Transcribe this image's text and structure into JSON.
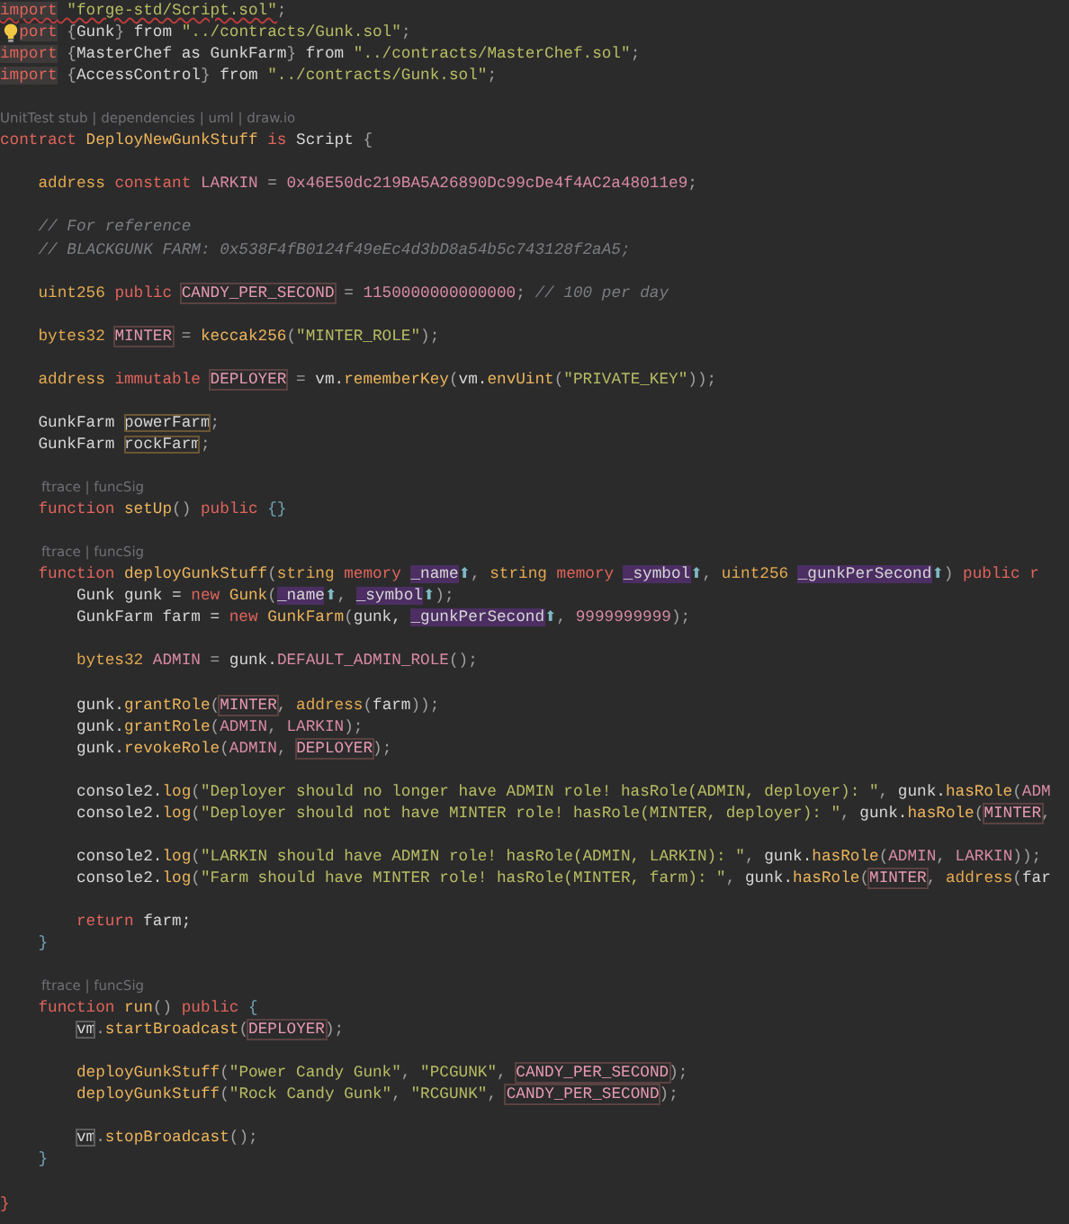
{
  "editor": {
    "lines": [
      {
        "kind": "code",
        "tokens": [
          {
            "kind": "err",
            "text": "import"
          },
          {
            "kind": "errs",
            "text": " \"forge-std/Script.sol\""
          },
          {
            "kind": "pun",
            "text": ";"
          }
        ]
      },
      {
        "kind": "code",
        "hint": true,
        "tokens": [
          {
            "kind": "imp",
            "text": "port"
          },
          {
            "kind": "pun",
            "text": " {"
          },
          {
            "kind": "id",
            "text": "Gunk"
          },
          {
            "kind": "pun",
            "text": "}"
          },
          {
            "kind": "id",
            "text": " from "
          },
          {
            "kind": "str",
            "text": "\"../contracts/Gunk.sol\""
          },
          {
            "kind": "pun",
            "text": ";"
          }
        ]
      },
      {
        "kind": "code",
        "tokens": [
          {
            "kind": "imp",
            "text": "import"
          },
          {
            "kind": "pun",
            "text": " {"
          },
          {
            "kind": "id",
            "text": "MasterChef as GunkFarm"
          },
          {
            "kind": "pun",
            "text": "}"
          },
          {
            "kind": "id",
            "text": " from "
          },
          {
            "kind": "str",
            "text": "\"../contracts/MasterChef.sol\""
          },
          {
            "kind": "pun",
            "text": ";"
          }
        ]
      },
      {
        "kind": "code",
        "tokens": [
          {
            "kind": "imp",
            "text": "import"
          },
          {
            "kind": "pun",
            "text": " {"
          },
          {
            "kind": "id",
            "text": "AccessControl"
          },
          {
            "kind": "pun",
            "text": "}"
          },
          {
            "kind": "id",
            "text": " from "
          },
          {
            "kind": "str",
            "text": "\"../contracts/Gunk.sol\""
          },
          {
            "kind": "pun",
            "text": ";"
          }
        ]
      },
      {
        "kind": "blank"
      },
      {
        "kind": "lens",
        "text": "UnitTest stub | dependencies | uml | draw.io"
      },
      {
        "kind": "code",
        "tokens": [
          {
            "kind": "kw",
            "text": "contract "
          },
          {
            "kind": "fn",
            "text": "DeployNewGunkStuff "
          },
          {
            "kind": "kw",
            "text": "is"
          },
          {
            "kind": "id",
            "text": " Script"
          },
          {
            "kind": "pun",
            "text": " {"
          }
        ]
      },
      {
        "kind": "blank"
      },
      {
        "kind": "code",
        "tokens": [
          {
            "kind": "type",
            "text": "    address"
          },
          {
            "kind": "kw",
            "text": " constant "
          },
          {
            "kind": "con",
            "text": "LARKIN"
          },
          {
            "kind": "pun",
            "text": " = "
          },
          {
            "kind": "num",
            "text": "0x46E50dc219BA5A26890Dc99cDe4f4AC2a48011e9"
          },
          {
            "kind": "pun",
            "text": ";"
          }
        ]
      },
      {
        "kind": "blank"
      },
      {
        "kind": "code",
        "tokens": [
          {
            "kind": "com",
            "text": "    // For reference"
          }
        ]
      },
      {
        "kind": "code",
        "tokens": [
          {
            "kind": "com",
            "text": "    // BLACKGUNK FARM: 0x538F4fB0124f49eEc4d3bD8a54b5c743128f2aA5;"
          }
        ]
      },
      {
        "kind": "blank"
      },
      {
        "kind": "code",
        "tokens": [
          {
            "kind": "type",
            "text": "    uint256 "
          },
          {
            "kind": "kw",
            "text": "public "
          },
          {
            "kind": "ref",
            "text": "CANDY_PER_SECOND"
          },
          {
            "kind": "pun",
            "text": " = "
          },
          {
            "kind": "num",
            "text": "1150000000000000"
          },
          {
            "kind": "pun",
            "text": "; "
          },
          {
            "kind": "com",
            "text": "// 100 per day"
          }
        ]
      },
      {
        "kind": "blank"
      },
      {
        "kind": "code",
        "tokens": [
          {
            "kind": "type",
            "text": "    bytes32 "
          },
          {
            "kind": "ref",
            "text": "MINTER"
          },
          {
            "kind": "pun",
            "text": " = "
          },
          {
            "kind": "fn",
            "text": "keccak256"
          },
          {
            "kind": "pun",
            "text": "("
          },
          {
            "kind": "str",
            "text": "\"MINTER_ROLE\""
          },
          {
            "kind": "pun",
            "text": ");"
          }
        ]
      },
      {
        "kind": "blank"
      },
      {
        "kind": "code",
        "tokens": [
          {
            "kind": "type",
            "text": "    address "
          },
          {
            "kind": "kw",
            "text": "immutable "
          },
          {
            "kind": "ref",
            "text": "DEPLOYER"
          },
          {
            "kind": "pun",
            "text": " = "
          },
          {
            "kind": "id",
            "text": "vm."
          },
          {
            "kind": "fn",
            "text": "rememberKey"
          },
          {
            "kind": "pun",
            "text": "("
          },
          {
            "kind": "id",
            "text": "vm."
          },
          {
            "kind": "fn",
            "text": "envUint"
          },
          {
            "kind": "pun",
            "text": "("
          },
          {
            "kind": "str",
            "text": "\"PRIVATE_KEY\""
          },
          {
            "kind": "pun",
            "text": "));"
          }
        ]
      },
      {
        "kind": "blank"
      },
      {
        "kind": "code",
        "tokens": [
          {
            "kind": "id",
            "text": "    GunkFarm "
          },
          {
            "kind": "var",
            "text": "powerFarm"
          },
          {
            "kind": "pun",
            "text": ";"
          }
        ]
      },
      {
        "kind": "code",
        "tokens": [
          {
            "kind": "id",
            "text": "    GunkFarm "
          },
          {
            "kind": "var",
            "text": "rockFarm"
          },
          {
            "kind": "pun",
            "text": ";"
          }
        ]
      },
      {
        "kind": "blank"
      },
      {
        "kind": "lens-inner",
        "text": "ftrace | funcSig"
      },
      {
        "kind": "code",
        "tokens": [
          {
            "kind": "kw",
            "text": "    function "
          },
          {
            "kind": "fn",
            "text": "setUp"
          },
          {
            "kind": "pun",
            "text": "() "
          },
          {
            "kind": "kw",
            "text": "public "
          },
          {
            "kind": "brace",
            "text": "{}"
          }
        ]
      },
      {
        "kind": "blank"
      },
      {
        "kind": "lens-inner",
        "text": "ftrace | funcSig"
      },
      {
        "kind": "code",
        "tokens": [
          {
            "kind": "kw",
            "text": "    function "
          },
          {
            "kind": "fn",
            "text": "deployGunkStuff"
          },
          {
            "kind": "pun",
            "text": "("
          },
          {
            "kind": "type",
            "text": "string "
          },
          {
            "kind": "kw",
            "text": "memory "
          },
          {
            "kind": "par",
            "text": "_name"
          },
          {
            "kind": "ico",
            "text": "⬆"
          },
          {
            "kind": "pun",
            "text": ", "
          },
          {
            "kind": "type",
            "text": "string "
          },
          {
            "kind": "kw",
            "text": "memory "
          },
          {
            "kind": "par",
            "text": "_symbol"
          },
          {
            "kind": "ico",
            "text": "⬆"
          },
          {
            "kind": "pun",
            "text": ", "
          },
          {
            "kind": "type",
            "text": "uint256 "
          },
          {
            "kind": "par",
            "text": "_gunkPerSecond"
          },
          {
            "kind": "ico",
            "text": "⬆"
          },
          {
            "kind": "pun",
            "text": ") "
          },
          {
            "kind": "kw",
            "text": "public r"
          }
        ]
      },
      {
        "kind": "code",
        "tokens": [
          {
            "kind": "id",
            "text": "        Gunk gunk = "
          },
          {
            "kind": "kw",
            "text": "new "
          },
          {
            "kind": "fn",
            "text": "Gunk"
          },
          {
            "kind": "pun",
            "text": "("
          },
          {
            "kind": "par",
            "text": "_name"
          },
          {
            "kind": "ico",
            "text": "⬆"
          },
          {
            "kind": "pun",
            "text": ", "
          },
          {
            "kind": "par",
            "text": "_symbol"
          },
          {
            "kind": "ico",
            "text": "⬆"
          },
          {
            "kind": "pun",
            "text": ");"
          }
        ]
      },
      {
        "kind": "code",
        "tokens": [
          {
            "kind": "id",
            "text": "        GunkFarm farm = "
          },
          {
            "kind": "kw",
            "text": "new "
          },
          {
            "kind": "fn",
            "text": "GunkFarm"
          },
          {
            "kind": "pun",
            "text": "("
          },
          {
            "kind": "id",
            "text": "gunk, "
          },
          {
            "kind": "par",
            "text": "_gunkPerSecond"
          },
          {
            "kind": "ico",
            "text": "⬆"
          },
          {
            "kind": "pun",
            "text": ", "
          },
          {
            "kind": "num",
            "text": "9999999999"
          },
          {
            "kind": "pun",
            "text": ");"
          }
        ]
      },
      {
        "kind": "blank"
      },
      {
        "kind": "code",
        "tokens": [
          {
            "kind": "type",
            "text": "        bytes32 "
          },
          {
            "kind": "con",
            "text": "ADMIN"
          },
          {
            "kind": "pun",
            "text": " = "
          },
          {
            "kind": "id",
            "text": "gunk."
          },
          {
            "kind": "con",
            "text": "DEFAULT_ADMIN_ROLE"
          },
          {
            "kind": "pun",
            "text": "();"
          }
        ]
      },
      {
        "kind": "blank"
      },
      {
        "kind": "code",
        "tokens": [
          {
            "kind": "id",
            "text": "        gunk."
          },
          {
            "kind": "fn",
            "text": "grantRole"
          },
          {
            "kind": "pun",
            "text": "("
          },
          {
            "kind": "ref",
            "text": "MINTER"
          },
          {
            "kind": "pun",
            "text": ", "
          },
          {
            "kind": "type",
            "text": "address"
          },
          {
            "kind": "pun",
            "text": "("
          },
          {
            "kind": "id",
            "text": "farm"
          },
          {
            "kind": "pun",
            "text": "));"
          }
        ]
      },
      {
        "kind": "code",
        "tokens": [
          {
            "kind": "id",
            "text": "        gunk."
          },
          {
            "kind": "fn",
            "text": "grantRole"
          },
          {
            "kind": "pun",
            "text": "("
          },
          {
            "kind": "con",
            "text": "ADMIN"
          },
          {
            "kind": "pun",
            "text": ", "
          },
          {
            "kind": "con",
            "text": "LARKIN"
          },
          {
            "kind": "pun",
            "text": ");"
          }
        ]
      },
      {
        "kind": "code",
        "tokens": [
          {
            "kind": "id",
            "text": "        gunk."
          },
          {
            "kind": "fn",
            "text": "revokeRole"
          },
          {
            "kind": "pun",
            "text": "("
          },
          {
            "kind": "con",
            "text": "ADMIN"
          },
          {
            "kind": "pun",
            "text": ", "
          },
          {
            "kind": "ref",
            "text": "DEPLOYER"
          },
          {
            "kind": "pun",
            "text": ");"
          }
        ]
      },
      {
        "kind": "blank"
      },
      {
        "kind": "code",
        "tokens": [
          {
            "kind": "id",
            "text": "        console2."
          },
          {
            "kind": "fn",
            "text": "log"
          },
          {
            "kind": "pun",
            "text": "("
          },
          {
            "kind": "str",
            "text": "\"Deployer should no longer have ADMIN role! hasRole(ADMIN, deployer): \""
          },
          {
            "kind": "pun",
            "text": ", "
          },
          {
            "kind": "id",
            "text": "gunk."
          },
          {
            "kind": "fn",
            "text": "hasRole"
          },
          {
            "kind": "pun",
            "text": "("
          },
          {
            "kind": "con",
            "text": "ADM"
          }
        ]
      },
      {
        "kind": "code",
        "tokens": [
          {
            "kind": "id",
            "text": "        console2."
          },
          {
            "kind": "fn",
            "text": "log"
          },
          {
            "kind": "pun",
            "text": "("
          },
          {
            "kind": "str",
            "text": "\"Deployer should not have MINTER role! hasRole(MINTER, deployer): \""
          },
          {
            "kind": "pun",
            "text": ", "
          },
          {
            "kind": "id",
            "text": "gunk."
          },
          {
            "kind": "fn",
            "text": "hasRole"
          },
          {
            "kind": "pun",
            "text": "("
          },
          {
            "kind": "ref",
            "text": "MINTER"
          },
          {
            "kind": "pun",
            "text": ","
          }
        ]
      },
      {
        "kind": "blank"
      },
      {
        "kind": "code",
        "tokens": [
          {
            "kind": "id",
            "text": "        console2."
          },
          {
            "kind": "fn",
            "text": "log"
          },
          {
            "kind": "pun",
            "text": "("
          },
          {
            "kind": "str",
            "text": "\"LARKIN should have ADMIN role! hasRole(ADMIN, LARKIN): \""
          },
          {
            "kind": "pun",
            "text": ", "
          },
          {
            "kind": "id",
            "text": "gunk."
          },
          {
            "kind": "fn",
            "text": "hasRole"
          },
          {
            "kind": "pun",
            "text": "("
          },
          {
            "kind": "con",
            "text": "ADMIN"
          },
          {
            "kind": "pun",
            "text": ", "
          },
          {
            "kind": "con",
            "text": "LARKIN"
          },
          {
            "kind": "pun",
            "text": "));"
          }
        ]
      },
      {
        "kind": "code",
        "tokens": [
          {
            "kind": "id",
            "text": "        console2."
          },
          {
            "kind": "fn",
            "text": "log"
          },
          {
            "kind": "pun",
            "text": "("
          },
          {
            "kind": "str",
            "text": "\"Farm should have MINTER role! hasRole(MINTER, farm): \""
          },
          {
            "kind": "pun",
            "text": ", "
          },
          {
            "kind": "id",
            "text": "gunk."
          },
          {
            "kind": "fn",
            "text": "hasRole"
          },
          {
            "kind": "pun",
            "text": "("
          },
          {
            "kind": "ref",
            "text": "MINTER"
          },
          {
            "kind": "pun",
            "text": ", "
          },
          {
            "kind": "type",
            "text": "address"
          },
          {
            "kind": "pun",
            "text": "("
          },
          {
            "kind": "id",
            "text": "far"
          }
        ]
      },
      {
        "kind": "blank"
      },
      {
        "kind": "code",
        "tokens": [
          {
            "kind": "kw",
            "text": "        return"
          },
          {
            "kind": "id",
            "text": " farm;"
          }
        ]
      },
      {
        "kind": "code",
        "tokens": [
          {
            "kind": "brace",
            "text": "    }"
          }
        ]
      },
      {
        "kind": "blank"
      },
      {
        "kind": "lens-inner",
        "text": "ftrace | funcSig"
      },
      {
        "kind": "code",
        "tokens": [
          {
            "kind": "kw",
            "text": "    function "
          },
          {
            "kind": "fn",
            "text": "run"
          },
          {
            "kind": "pun",
            "text": "() "
          },
          {
            "kind": "kw",
            "text": "public "
          },
          {
            "kind": "brace",
            "text": "{"
          }
        ]
      },
      {
        "kind": "code",
        "tokens": [
          {
            "kind": "vm",
            "text": "        vm"
          },
          {
            "kind": "pun",
            "text": "."
          },
          {
            "kind": "fn",
            "text": "startBroadcast"
          },
          {
            "kind": "pun",
            "text": "("
          },
          {
            "kind": "ref",
            "text": "DEPLOYER"
          },
          {
            "kind": "pun",
            "text": ");"
          }
        ]
      },
      {
        "kind": "blank"
      },
      {
        "kind": "code",
        "tokens": [
          {
            "kind": "fn",
            "text": "        deployGunkStuff"
          },
          {
            "kind": "pun",
            "text": "("
          },
          {
            "kind": "str",
            "text": "\"Power Candy Gunk\""
          },
          {
            "kind": "pun",
            "text": ", "
          },
          {
            "kind": "str",
            "text": "\"PCGUNK\""
          },
          {
            "kind": "pun",
            "text": ", "
          },
          {
            "kind": "ref",
            "text": "CANDY_PER_SECOND"
          },
          {
            "kind": "pun",
            "text": ");"
          }
        ]
      },
      {
        "kind": "code",
        "tokens": [
          {
            "kind": "fn",
            "text": "        deployGunkStuff"
          },
          {
            "kind": "pun",
            "text": "("
          },
          {
            "kind": "str",
            "text": "\"Rock Candy Gunk\""
          },
          {
            "kind": "pun",
            "text": ", "
          },
          {
            "kind": "str",
            "text": "\"RCGUNK\""
          },
          {
            "kind": "pun",
            "text": ", "
          },
          {
            "kind": "ref",
            "text": "CANDY_PER_SECOND"
          },
          {
            "kind": "pun",
            "text": ");"
          }
        ]
      },
      {
        "kind": "blank"
      },
      {
        "kind": "code",
        "tokens": [
          {
            "kind": "vm",
            "text": "        vm"
          },
          {
            "kind": "pun",
            "text": "."
          },
          {
            "kind": "fn",
            "text": "stopBroadcast"
          },
          {
            "kind": "pun",
            "text": "();"
          }
        ]
      },
      {
        "kind": "code",
        "tokens": [
          {
            "kind": "brace",
            "text": "    }"
          }
        ]
      },
      {
        "kind": "blank"
      },
      {
        "kind": "code",
        "tokens": [
          {
            "kind": "kw",
            "text": "}"
          }
        ]
      }
    ]
  }
}
